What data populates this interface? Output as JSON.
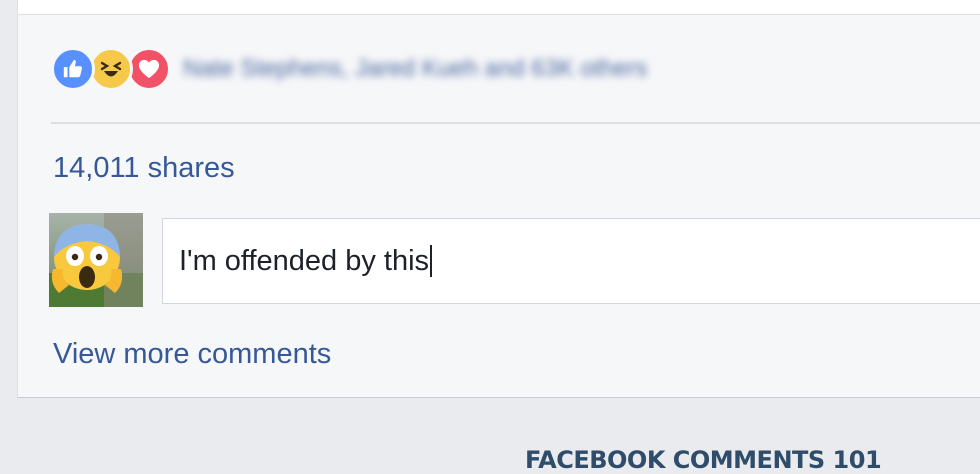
{
  "reactions": [
    {
      "name": "like",
      "icon": "thumbs-up-icon",
      "color": "#5890ff"
    },
    {
      "name": "haha",
      "icon": "laughing-face-icon",
      "color": "#f7c94b"
    },
    {
      "name": "love",
      "icon": "heart-icon",
      "color": "#f25268"
    }
  ],
  "reactors_text": "Nate Stephens, Jared Kueh and 63K others",
  "shares_text": "14,011 shares",
  "comment": {
    "value": "I'm offended by this",
    "avatar_icon": "screaming-face-emoji-icon"
  },
  "view_more_label": "View more comments",
  "footer_title": "FACEBOOK COMMENTS 101",
  "colors": {
    "link": "#365899",
    "card_bg": "#f6f7f9",
    "page_bg": "#e9ebee",
    "footer_text": "#2f4d6b"
  }
}
